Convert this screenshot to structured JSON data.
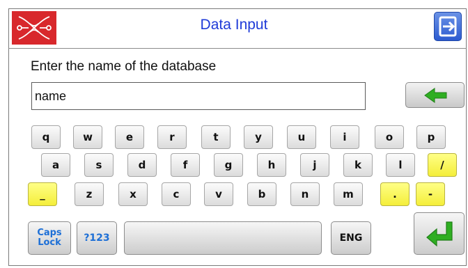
{
  "header": {
    "title": "Data Input",
    "logo": "brand-logo",
    "exit_icon": "exit-icon"
  },
  "prompt": "Enter the name of the database",
  "input": {
    "value": "name"
  },
  "back_icon": "left-arrow-icon",
  "colors": {
    "title": "#1f3bd8",
    "highlight_key": "#f6f03c",
    "accent_green": "#2fae22",
    "brand_red": "#d8282c"
  },
  "keyboard": {
    "row1": [
      "q",
      "w",
      "e",
      "r",
      "t",
      "y",
      "u",
      "i",
      "o",
      "p"
    ],
    "row2": [
      "a",
      "s",
      "d",
      "f",
      "g",
      "h",
      "j",
      "k",
      "l",
      "/"
    ],
    "row3": [
      "_",
      "z",
      "x",
      "c",
      "v",
      "b",
      "n",
      "m",
      ".",
      "-"
    ],
    "caps_line1": "Caps",
    "caps_line2": "Lock",
    "symbols": "?123",
    "space": "",
    "language": "ENG",
    "enter_icon": "enter-icon"
  }
}
